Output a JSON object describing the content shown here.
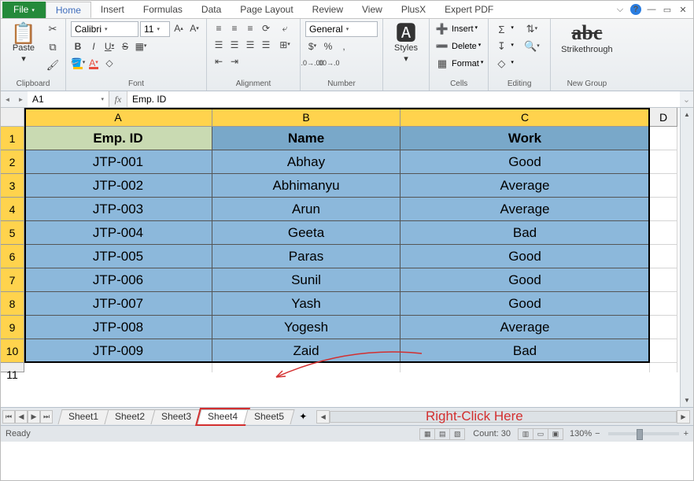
{
  "menu": {
    "file": "File",
    "tabs": [
      "Home",
      "Insert",
      "Formulas",
      "Data",
      "Page Layout",
      "Review",
      "View",
      "PlusX",
      "Expert PDF"
    ],
    "active": "Home"
  },
  "ribbon": {
    "clipboard": {
      "label": "Clipboard",
      "paste": "Paste"
    },
    "font": {
      "label": "Font",
      "family": "Calibri",
      "size": "11"
    },
    "alignment": {
      "label": "Alignment"
    },
    "number": {
      "label": "Number",
      "format": "General"
    },
    "styles": {
      "label": "Styles",
      "btn": "Styles"
    },
    "cells": {
      "label": "Cells",
      "insert": "Insert",
      "delete": "Delete",
      "format": "Format"
    },
    "editing": {
      "label": "Editing"
    },
    "newgroup": {
      "label": "New Group",
      "strike": "Strikethrough"
    }
  },
  "fx": {
    "cell": "A1",
    "value": "Emp. ID"
  },
  "cols": [
    "A",
    "B",
    "C",
    "D"
  ],
  "rows": [
    1,
    2,
    3,
    4,
    5,
    6,
    7,
    8,
    9,
    10,
    11
  ],
  "headers": [
    "Emp. ID",
    "Name",
    "Work"
  ],
  "data": [
    [
      "JTP-001",
      "Abhay",
      "Good"
    ],
    [
      "JTP-002",
      "Abhimanyu",
      "Average"
    ],
    [
      "JTP-003",
      "Arun",
      "Average"
    ],
    [
      "JTP-004",
      "Geeta",
      "Bad"
    ],
    [
      "JTP-005",
      "Paras",
      "Good"
    ],
    [
      "JTP-006",
      "Sunil",
      "Good"
    ],
    [
      "JTP-007",
      "Yash",
      "Good"
    ],
    [
      "JTP-008",
      "Yogesh",
      "Average"
    ],
    [
      "JTP-009",
      "Zaid",
      "Bad"
    ]
  ],
  "sheets": [
    "Sheet1",
    "Sheet2",
    "Sheet3",
    "Sheet4",
    "Sheet5"
  ],
  "active_sheet": "Sheet4",
  "annotation": "Right-Click Here",
  "status": {
    "ready": "Ready",
    "count": "Count: 30",
    "zoom": "130%"
  }
}
